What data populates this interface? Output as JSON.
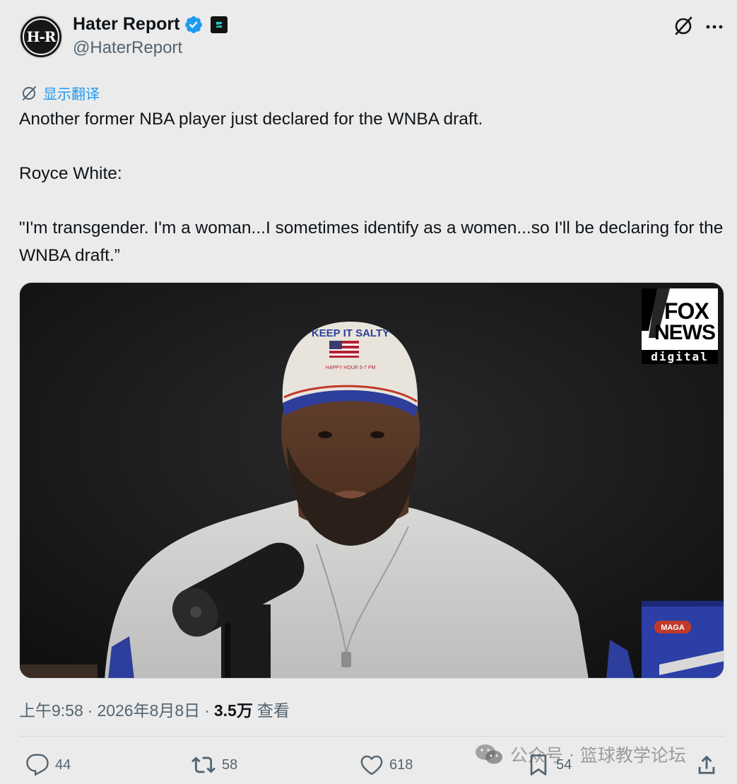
{
  "author": {
    "avatar_text": "H-R",
    "display_name": "Hater Report",
    "handle": "@HaterReport"
  },
  "translate_label": "显示翻译",
  "tweet": {
    "line1": "Another former NBA player just declared for the WNBA draft.",
    "line2": "Royce White:",
    "line3": "\"I'm transgender. I'm a woman...I sometimes identify as a women...so I'll be declaring for the WNBA draft.”"
  },
  "media": {
    "fox_word1": "FOX",
    "fox_word2": "NEWS",
    "fox_word3": "digital",
    "cap_text": "KEEP IT SALTY",
    "cap_subtext": "HAPPY HOUR 5-7 PM",
    "box_label": "MAGA"
  },
  "meta": {
    "time": "上午9:58",
    "sep1": "·",
    "date": "2026年8月8日",
    "sep2": "·",
    "views": "3.5万",
    "views_label": "查看"
  },
  "actions": {
    "replies": "44",
    "reposts": "58",
    "likes": "618",
    "bookmarks": "54"
  },
  "watermark": {
    "text": "公众号 · 篮球教学论坛"
  },
  "colors": {
    "accent": "#1d9bf0",
    "secondary_text": "#536471",
    "background": "#ebebeb"
  },
  "icons": [
    "verified-badge-icon",
    "brand-badge-icon",
    "grok-icon",
    "more-icon",
    "translate-icon",
    "reply-icon",
    "repost-icon",
    "like-icon",
    "bookmark-icon",
    "share-icon",
    "wechat-icon"
  ]
}
